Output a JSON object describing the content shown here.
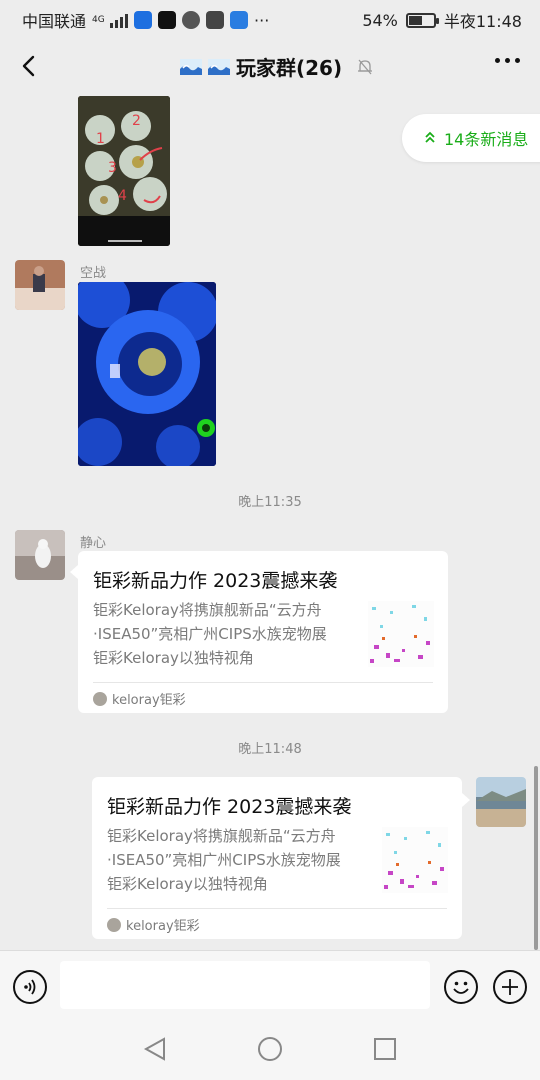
{
  "status_bar": {
    "carrier": "中国联通",
    "network": "4G",
    "battery": "54%",
    "battery_level": 0.54,
    "time": "半夜11:48",
    "more": "···"
  },
  "header": {
    "title": "玩家群(26)",
    "back_icon": "chevron-left-icon",
    "more_icon": "more-dots-icon"
  },
  "new_messages": {
    "label": "14条新消息",
    "icon": "double-chevron-up-icon",
    "accent": "#1aad19"
  },
  "messages": {
    "m1": {
      "sender": "空战"
    },
    "time1": "晚上11:35",
    "m2": {
      "sender": "静心",
      "title": "钜彩新品力作 2023震撼来袭",
      "desc_line1": "钜彩Keloray将携旗舰新品“云方舟",
      "desc_line2": "·ISEA50”亮相广州CIPS水族宠物展",
      "desc_line3": "钜彩Keloray以独特视角",
      "source": "keloray钜彩"
    },
    "time2": "晚上11:48",
    "m3": {
      "title": "钜彩新品力作 2023震撼来袭",
      "desc_line1": "钜彩Keloray将携旗舰新品“云方舟",
      "desc_line2": "·ISEA50”亮相广州CIPS水族宠物展",
      "desc_line3": "钜彩Keloray以独特视角",
      "source": "keloray钜彩"
    }
  },
  "image_labels": [
    "1",
    "2",
    "3",
    "4"
  ],
  "input_bar": {
    "voice_icon": "voice-icon",
    "emoji_icon": "emoji-icon",
    "plus_icon": "plus-icon"
  },
  "nav_bar": {
    "back_icon": "nav-back-icon",
    "home_icon": "nav-home-icon",
    "recents_icon": "nav-recents-icon"
  }
}
